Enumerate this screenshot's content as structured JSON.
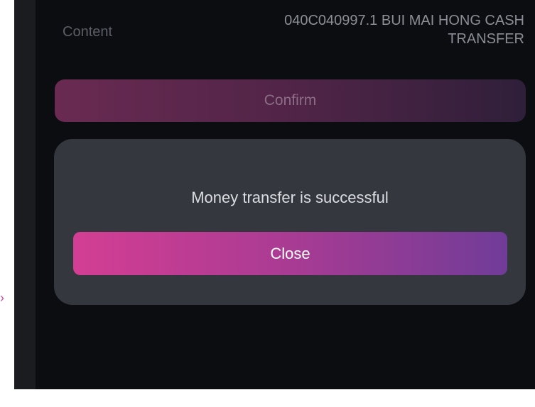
{
  "transfer": {
    "content_label": "Content",
    "content_value_line1": "040C040997.1 BUI MAI HONG CASH",
    "content_value_line2": "TRANSFER",
    "confirm_label": "Confirm"
  },
  "dialog": {
    "message": "Money transfer is successful",
    "close_label": "Close"
  },
  "marker": {
    "glyph": "›"
  },
  "colors": {
    "background": "#0c0d11",
    "dialog": "#34373e",
    "close_gradient_start": "#d33e93",
    "close_gradient_end": "#703c98"
  }
}
